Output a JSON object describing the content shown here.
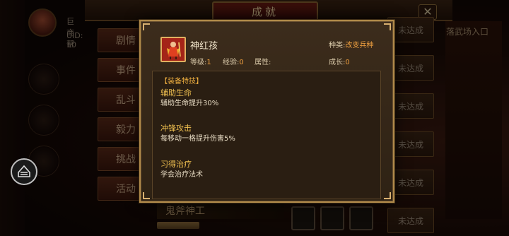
{
  "window": {
    "title": "成就",
    "close_glyph": "✕"
  },
  "user": {
    "name": "巨商帮",
    "uid": "UID: 10"
  },
  "left_menu": [
    "剧情",
    "事件",
    "乱斗",
    "毅力",
    "挑战",
    "活动"
  ],
  "right_side": {
    "link": "落武场入口"
  },
  "status_buttons": [
    "未达成",
    "未达成",
    "未达成",
    "未达成",
    "未达成",
    "未达成"
  ],
  "bottom_row": {
    "title": "鬼斧神工"
  },
  "left_float": {
    "icon": "helmet-icon"
  },
  "popup": {
    "unit_name": "神红孩",
    "type_label": "种类:",
    "type_value": "改变兵种",
    "stats": {
      "level_label": "等级:",
      "level_value": "1",
      "exp_label": "经验:",
      "exp_value": "0",
      "attr_label": "属性:",
      "attr_value": "",
      "growth_label": "成长:",
      "growth_value": "0"
    },
    "skills_header": "【装备特技】",
    "skills": [
      {
        "name": "辅助生命",
        "desc": "辅助生命提升30%"
      },
      {
        "name": "冲锋攻击",
        "desc": "每移动一格提升伤害5%"
      },
      {
        "name": "习得治疗",
        "desc": "学会治疗法术"
      }
    ]
  },
  "colors": {
    "accent_orange": "#f0a040",
    "skill_title": "#f0c050",
    "frame_gold": "#b08a4a",
    "panel_brown": "#3c2c1c"
  }
}
